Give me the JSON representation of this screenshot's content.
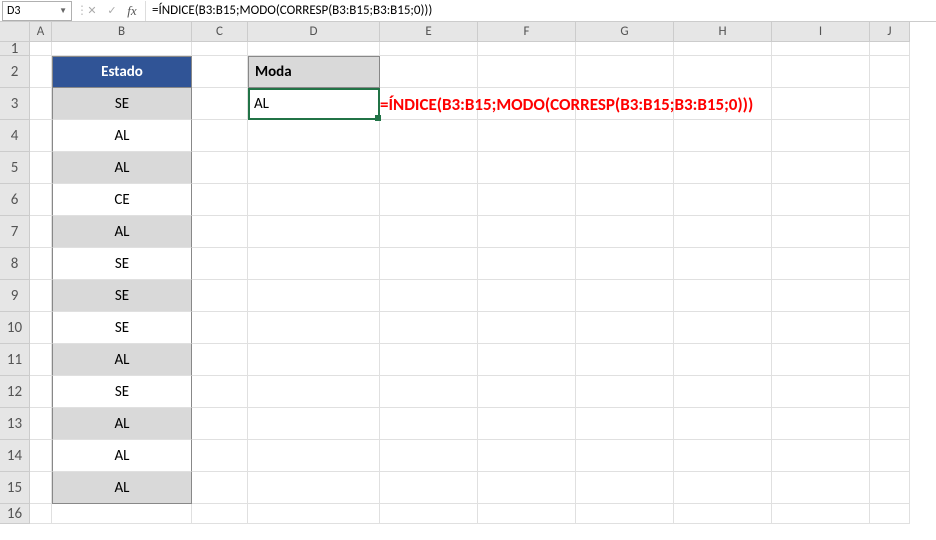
{
  "namebox": {
    "value": "D3"
  },
  "formula_bar": {
    "formula": "=ÍNDICE(B3:B15;MODO(CORRESP(B3:B15;B3:B15;0)))"
  },
  "columns": [
    "A",
    "B",
    "C",
    "D",
    "E",
    "F",
    "G",
    "H",
    "I",
    "J"
  ],
  "rows": [
    "1",
    "2",
    "3",
    "4",
    "5",
    "6",
    "7",
    "8",
    "9",
    "10",
    "11",
    "12",
    "13",
    "14",
    "15",
    "16"
  ],
  "table": {
    "header": "Estado",
    "values": [
      "SE",
      "AL",
      "AL",
      "CE",
      "AL",
      "SE",
      "SE",
      "SE",
      "AL",
      "SE",
      "AL",
      "AL",
      "AL"
    ]
  },
  "result": {
    "header": "Moda",
    "value": "AL"
  },
  "annotation": "=ÍNDICE(B3:B15;MODO(CORRESP(B3:B15;B3:B15;0)))"
}
